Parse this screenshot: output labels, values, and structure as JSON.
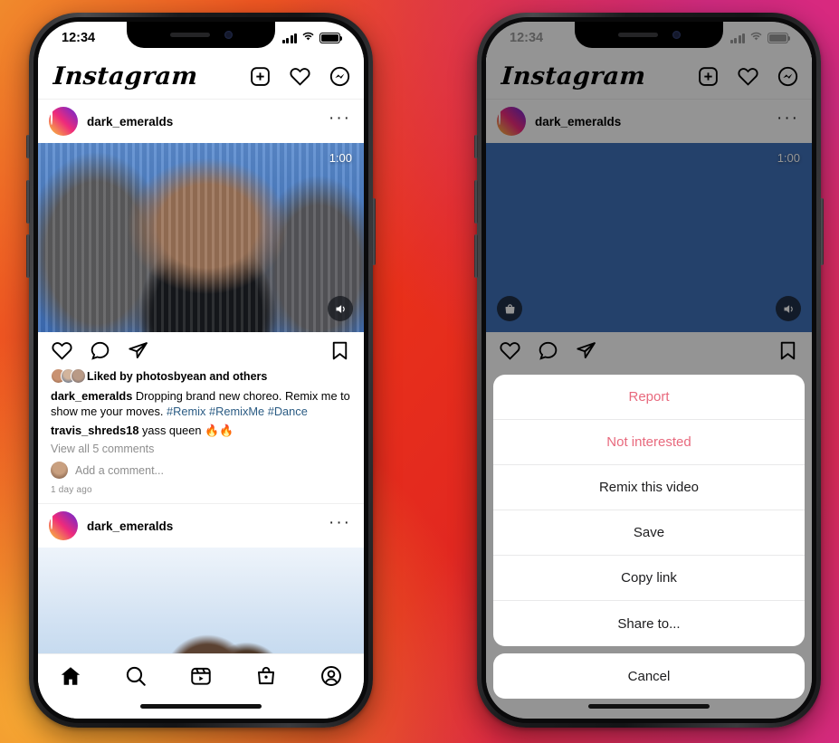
{
  "background": {
    "gradient_colors": [
      "#F0962E",
      "#EE5622",
      "#E8301A",
      "#D92B4E",
      "#D42A7E"
    ]
  },
  "phones": {
    "left": {
      "name": "instagram-feed-screen",
      "status_bar": {
        "time": "12:34",
        "signal": "signal-icon",
        "wifi": "wifi-icon",
        "battery": "battery-icon"
      },
      "header": {
        "wordmark": "Instagram",
        "icons": [
          {
            "name": "add-post-icon",
            "label": "Create"
          },
          {
            "name": "activity-heart-icon",
            "label": "Activity"
          },
          {
            "name": "messenger-icon",
            "label": "Messages"
          }
        ]
      },
      "post": {
        "username": "dark_emeralds",
        "more_options": "···",
        "media": {
          "duration": "1:00",
          "muted_toggle": "audio-icon"
        },
        "actions": [
          "like-icon",
          "comment-icon",
          "share-icon",
          "bookmark-icon"
        ],
        "liked_by": "Liked by photosbyean and others",
        "caption_user": "dark_emeralds",
        "caption_text": "Dropping brand new choreo. Remix me to show me your moves.",
        "hashtags": [
          "#Remix",
          "#RemixMe",
          "#Dance"
        ],
        "comment_user": "travis_shreds18",
        "comment_text": "yass queen 🔥🔥",
        "view_all_comments": "View all 5 comments",
        "add_comment_placeholder": "Add a comment...",
        "timestamp": "1 day ago"
      },
      "post2": {
        "username": "dark_emeralds",
        "more_options": "···"
      },
      "tabbar": [
        {
          "name": "tab-home",
          "label": "Home",
          "active": true
        },
        {
          "name": "tab-search",
          "label": "Search",
          "active": false
        },
        {
          "name": "tab-reels",
          "label": "Reels",
          "active": false
        },
        {
          "name": "tab-shop",
          "label": "Shop",
          "active": false
        },
        {
          "name": "tab-profile",
          "label": "Profile",
          "active": false
        }
      ]
    },
    "right": {
      "name": "instagram-action-sheet-screen",
      "status_bar": {
        "time": "12:34"
      },
      "header": {
        "wordmark": "Instagram"
      },
      "post": {
        "username": "dark_emeralds",
        "more_options": "···",
        "media": {
          "duration": "1:00"
        }
      },
      "action_sheet": {
        "items": [
          {
            "label": "Report",
            "style": "danger"
          },
          {
            "label": "Not interested",
            "style": "danger"
          },
          {
            "label": "Remix this video",
            "style": "default"
          },
          {
            "label": "Save",
            "style": "default"
          },
          {
            "label": "Copy link",
            "style": "default"
          },
          {
            "label": "Share to...",
            "style": "default"
          }
        ],
        "cancel_label": "Cancel",
        "danger_color": "#e8697d"
      }
    }
  }
}
